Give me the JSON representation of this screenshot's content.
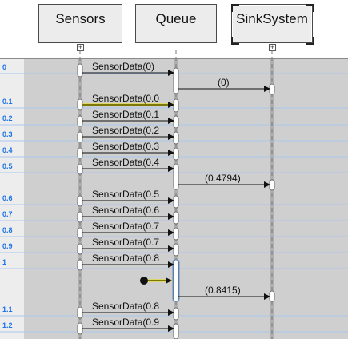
{
  "lifelines": [
    {
      "name": "Sensors"
    },
    {
      "name": "Queue"
    },
    {
      "name": "SinkSystem"
    }
  ],
  "time_ticks": [
    "0",
    "0.1",
    "0.2",
    "0.3",
    "0.4",
    "0.5",
    "0.6",
    "0.7",
    "0.8",
    "0.9",
    "1",
    "1.1",
    "1.2"
  ],
  "messages": [
    {
      "label": "SensorData(0)",
      "from": "Sensors",
      "to": "Queue"
    },
    {
      "label": "(0)",
      "from": "Queue",
      "to": "SinkSystem"
    },
    {
      "label": "SensorData(0.0",
      "from": "Sensors",
      "to": "Queue",
      "highlighted": true
    },
    {
      "label": "SensorData(0.1",
      "from": "Sensors",
      "to": "Queue"
    },
    {
      "label": "SensorData(0.2",
      "from": "Sensors",
      "to": "Queue"
    },
    {
      "label": "SensorData(0.3",
      "from": "Sensors",
      "to": "Queue"
    },
    {
      "label": "SensorData(0.4",
      "from": "Sensors",
      "to": "Queue"
    },
    {
      "label": "(0.4794)",
      "from": "Queue",
      "to": "SinkSystem"
    },
    {
      "label": "SensorData(0.5",
      "from": "Sensors",
      "to": "Queue"
    },
    {
      "label": "SensorData(0.6",
      "from": "Sensors",
      "to": "Queue"
    },
    {
      "label": "SensorData(0.7",
      "from": "Sensors",
      "to": "Queue"
    },
    {
      "label": "SensorData(0.7",
      "from": "Sensors",
      "to": "Queue"
    },
    {
      "label": "SensorData(0.8",
      "from": "Sensors",
      "to": "Queue"
    },
    {
      "label": "(0.8415)",
      "from": "Queue",
      "to": "SinkSystem"
    },
    {
      "label": "SensorData(0.8",
      "from": "Sensors",
      "to": "Queue"
    },
    {
      "label": "SensorData(0.9",
      "from": "Sensors",
      "to": "Queue"
    }
  ],
  "colors": {
    "tick_text": "#1a73e8",
    "grid_line": "#a9c7ee",
    "lane_bg": "#cfcfcf",
    "gutter_bg": "#d6d6d6",
    "highlight": "#e8e000"
  }
}
